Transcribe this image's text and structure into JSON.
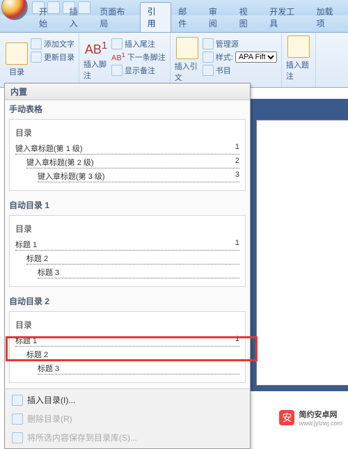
{
  "titlebar": {
    "qat": [
      "save",
      "undo",
      "redo",
      "dropdown"
    ]
  },
  "tabs": {
    "items": [
      "开始",
      "插入",
      "页面布局",
      "引用",
      "邮件",
      "审阅",
      "视图",
      "开发工具",
      "加载项"
    ],
    "active": 3
  },
  "ribbon": {
    "toc_btn": "目录",
    "add_text": "添加文字",
    "update_toc": "更新目录",
    "insert_footnote": "插入脚注",
    "ab_label": "AB",
    "insert_endnote": "插入尾注",
    "next_footnote": "下一条脚注",
    "show_notes": "显示备注",
    "insert_citation": "插入引文",
    "manage_sources": "管理源",
    "style_label": "样式:",
    "style_value": "APA Fifth",
    "bibliography": "书目",
    "insert_caption": "插入题注",
    "group_toc": "目录",
    "group_cite": "书目"
  },
  "dropdown": {
    "header": "内置",
    "manual": {
      "title": "手动表格",
      "heading": "目录",
      "lines": [
        {
          "label": "键入章标题(第 1 级)",
          "page": "1",
          "indent": 0
        },
        {
          "label": "键入章标题(第 2 级)",
          "page": "2",
          "indent": 1
        },
        {
          "label": "键入章标题(第 3 级)",
          "page": "3",
          "indent": 2
        }
      ]
    },
    "auto1": {
      "title": "自动目录 1",
      "heading": "目录",
      "lines": [
        {
          "label": "标题 1",
          "page": "1",
          "indent": 0
        },
        {
          "label": "标题 2",
          "page": "",
          "indent": 1
        },
        {
          "label": "标题 3",
          "page": "",
          "indent": 2
        }
      ]
    },
    "auto2": {
      "title": "自动目录 2",
      "heading": "目录",
      "lines": [
        {
          "label": "标题 1",
          "page": "1",
          "indent": 0
        },
        {
          "label": "标题 2",
          "page": "",
          "indent": 1
        },
        {
          "label": "标题 3",
          "page": "",
          "indent": 2
        }
      ]
    },
    "cmd_insert": "插入目录(I)...",
    "cmd_remove": "删除目录(R)",
    "cmd_save": "将所选内容保存到目录库(S)..."
  },
  "watermark": {
    "text": "简约安卓网",
    "url": "www.jylzwj.com"
  }
}
